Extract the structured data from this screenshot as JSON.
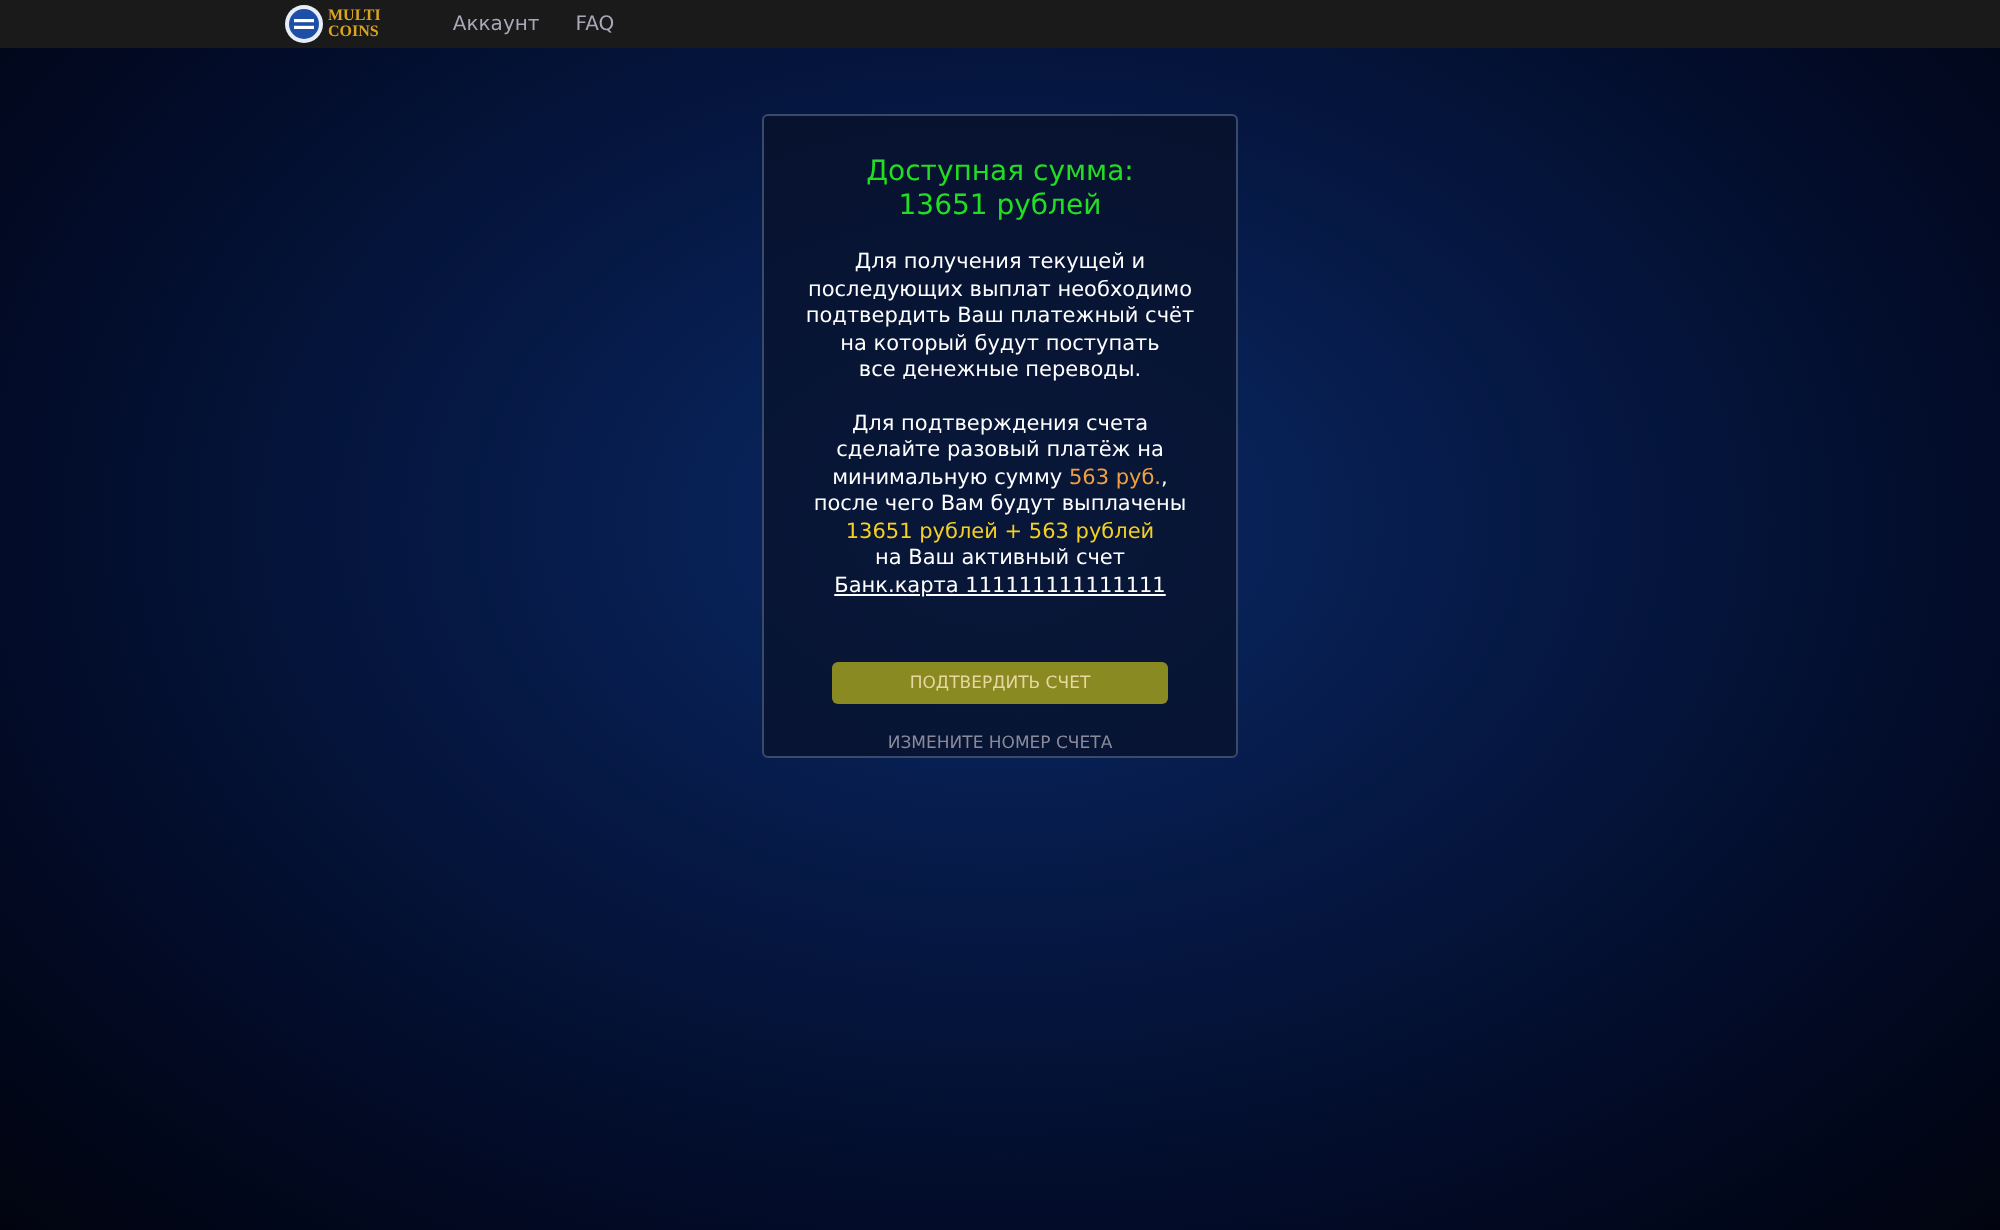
{
  "navbar": {
    "logo_lines": [
      "MULTI",
      "COINS"
    ],
    "links": [
      "Аккаунт",
      "FAQ"
    ]
  },
  "card": {
    "title_lines": [
      "Доступная сумма:",
      "13651 рублей"
    ],
    "intro_lines": [
      "Для получения текущей и",
      "последующих выплат необходимо",
      "подтвердить Ваш платежный счёт",
      "на который будут поступать",
      "все денежные переводы."
    ],
    "offer_lines": [
      [
        {
          "kind": "plain",
          "text": "Для подтверждения счета"
        }
      ],
      [
        {
          "kind": "plain",
          "text": "сделайте разовый платёж на"
        }
      ],
      [
        {
          "kind": "plain",
          "text": "минимальную сумму "
        },
        {
          "kind": "amount",
          "text": "563 руб."
        },
        {
          "kind": "plain",
          "text": ","
        }
      ],
      [
        {
          "kind": "plain",
          "text": "после чего Вам будут выплачены"
        }
      ],
      [
        {
          "kind": "total",
          "text": "13651 рублей + 563 рублей"
        }
      ],
      [
        {
          "kind": "plain",
          "text": "на Ваш активный счет"
        }
      ],
      [
        {
          "kind": "link",
          "text": "Банк.карта 111111111111111"
        }
      ]
    ],
    "confirm_button": "ПОДТВЕРДИТЬ СЧЕТ",
    "change_link": "ИЗМЕНИТЕ НОМЕР СЧЕТА"
  }
}
